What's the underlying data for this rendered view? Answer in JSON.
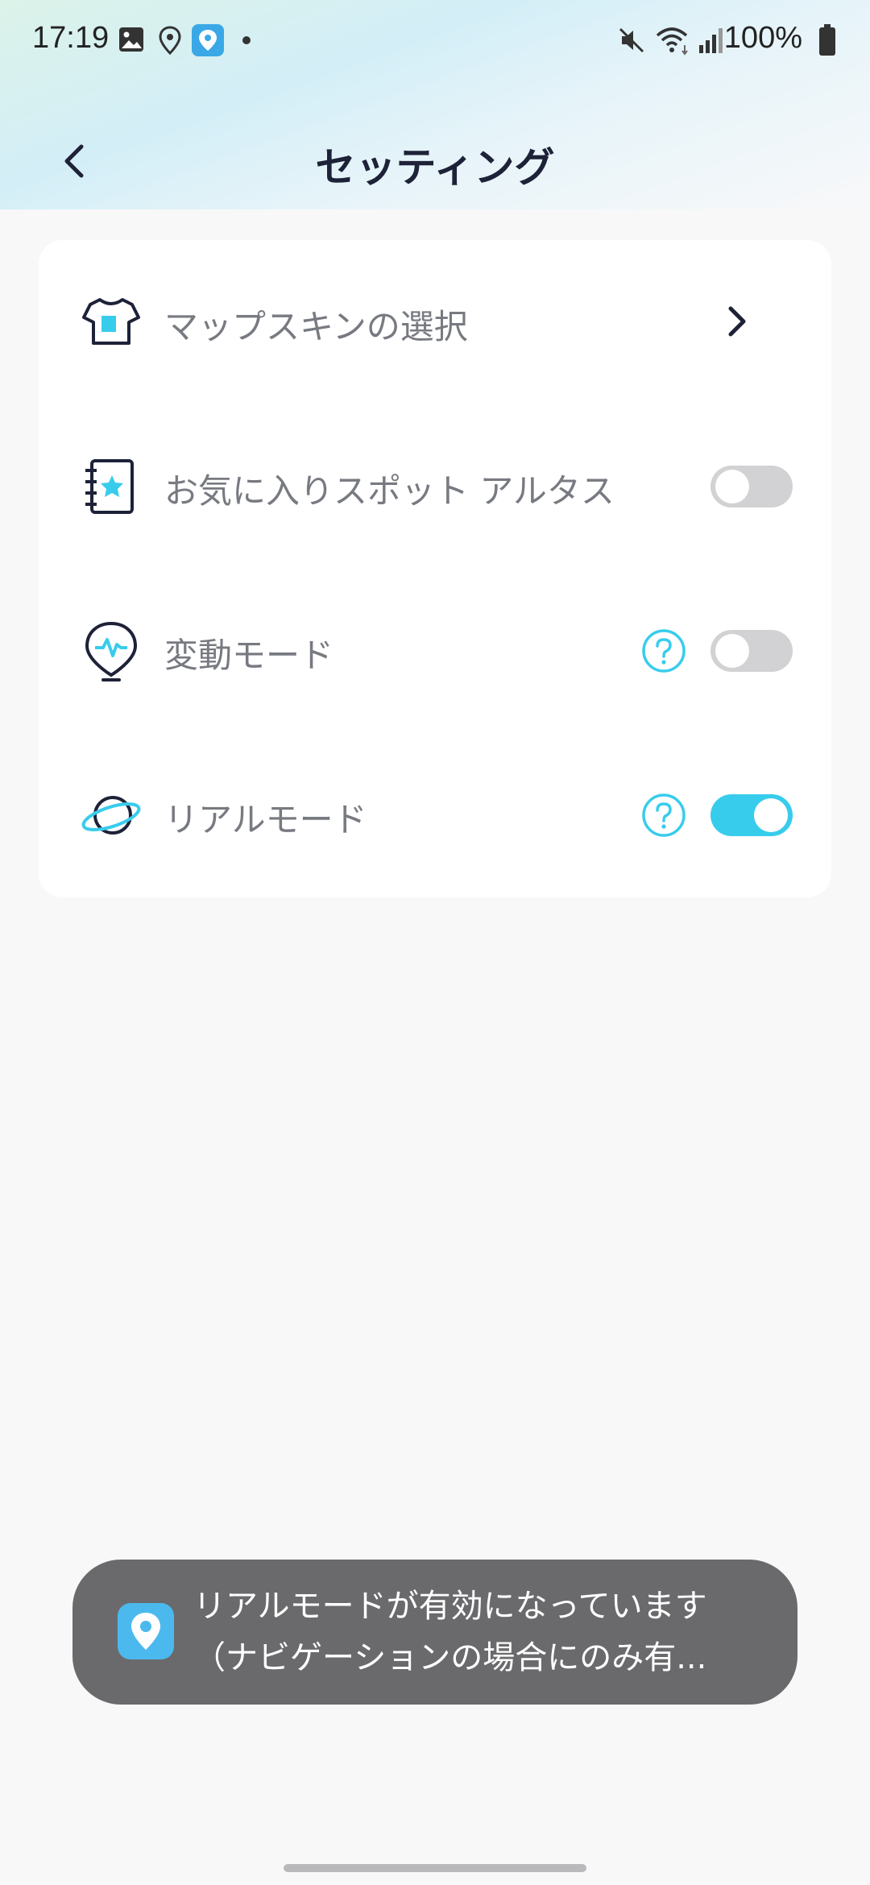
{
  "status_bar": {
    "time": "17:19",
    "battery": "100%",
    "icons": [
      "gallery-icon",
      "location-icon",
      "app-icon",
      "dot-icon",
      "mute-icon",
      "wifi-icon",
      "signal-icon",
      "battery-icon"
    ]
  },
  "header": {
    "title": "セッティング",
    "back_icon": "chevron-left-icon"
  },
  "settings": {
    "items": [
      {
        "label": "マップスキンの選択",
        "icon": "tshirt-icon",
        "control": "chevron"
      },
      {
        "label": "お気に入りスポット アルタス",
        "icon": "favorites-book-icon",
        "control": "toggle",
        "on": false
      },
      {
        "label": "変動モード",
        "icon": "pulse-pin-icon",
        "control": "toggle",
        "on": false,
        "help": true
      },
      {
        "label": "リアルモード",
        "icon": "planet-icon",
        "control": "toggle",
        "on": true,
        "help": true
      }
    ]
  },
  "toast": {
    "line1": "リアルモードが有効になっています",
    "line2": "（ナビゲーションの場合にのみ有...",
    "icon": "app-pin-icon"
  },
  "colors": {
    "accent": "#38ccec",
    "dark": "#1e2238",
    "label": "#777a80",
    "toggle_off": "#d2d2d4",
    "toast_bg": "#6a6a6c"
  }
}
